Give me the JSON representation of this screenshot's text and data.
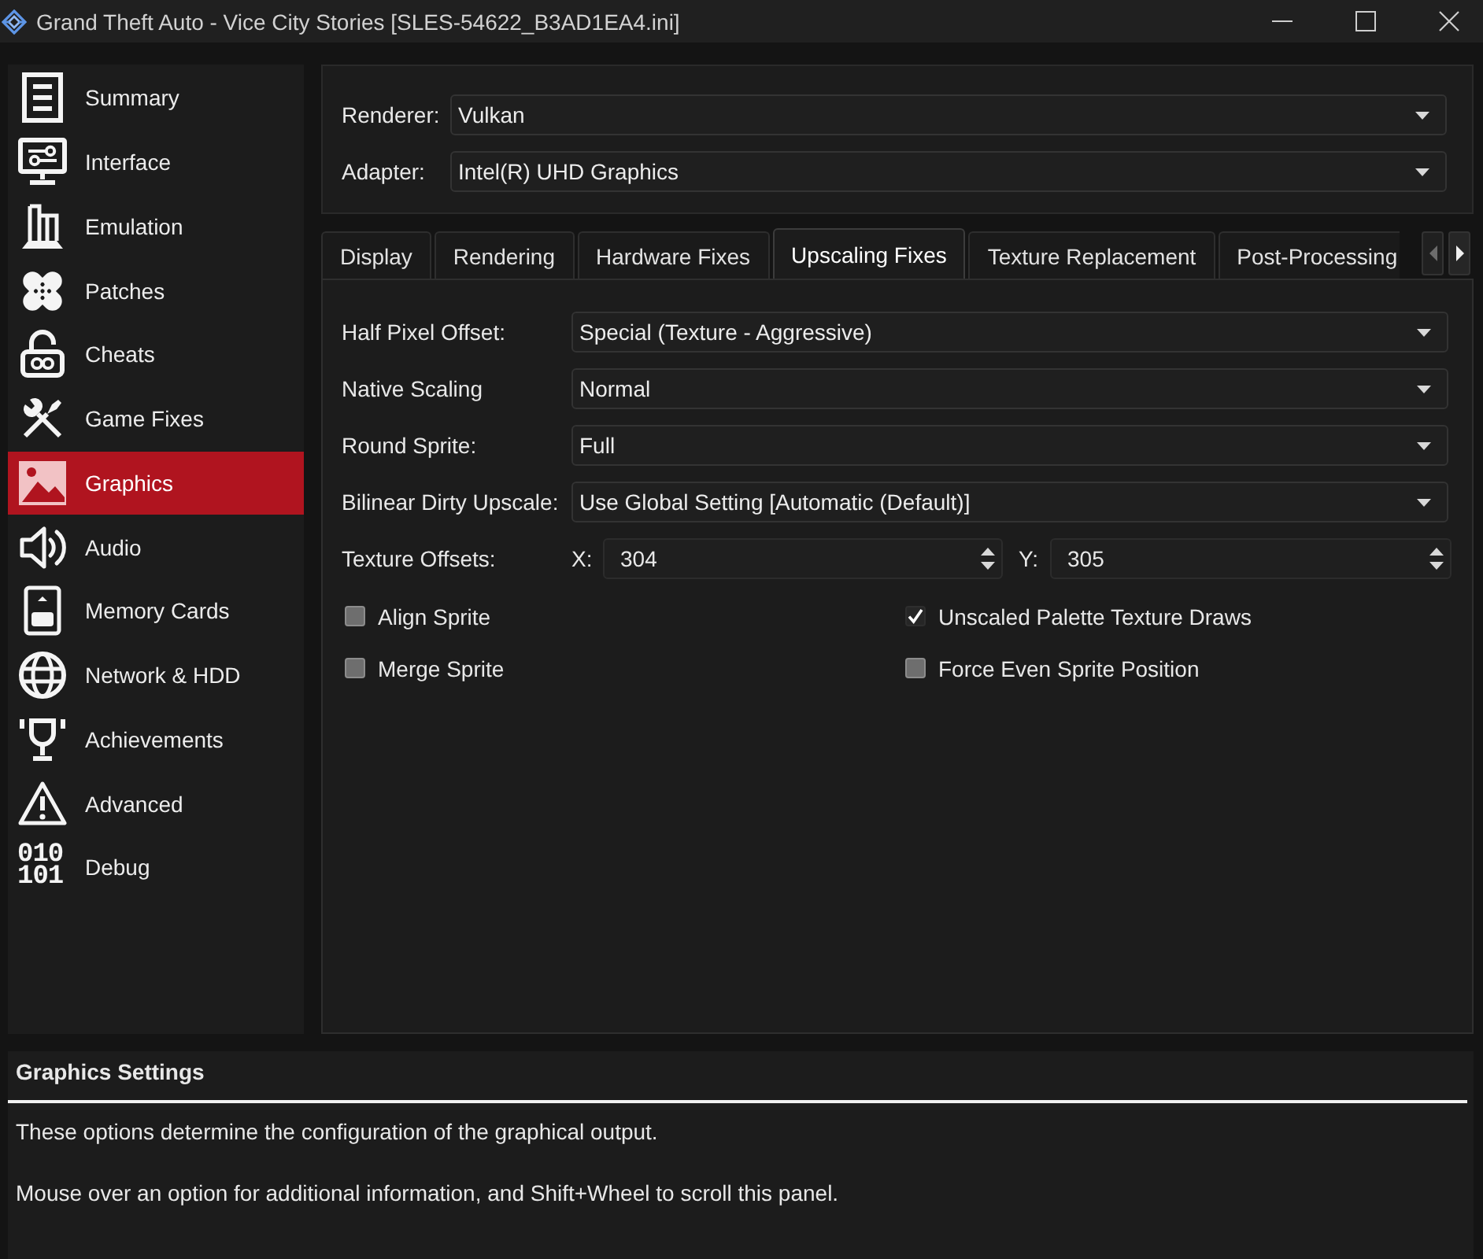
{
  "window": {
    "title": "Grand Theft Auto - Vice City Stories [SLES-54622_B3AD1EA4.ini]"
  },
  "sidebar": {
    "items": [
      {
        "label": "Summary",
        "selected": false
      },
      {
        "label": "Interface",
        "selected": false
      },
      {
        "label": "Emulation",
        "selected": false
      },
      {
        "label": "Patches",
        "selected": false
      },
      {
        "label": "Cheats",
        "selected": false
      },
      {
        "label": "Game Fixes",
        "selected": false
      },
      {
        "label": "Graphics",
        "selected": true
      },
      {
        "label": "Audio",
        "selected": false
      },
      {
        "label": "Memory Cards",
        "selected": false
      },
      {
        "label": "Network & HDD",
        "selected": false
      },
      {
        "label": "Achievements",
        "selected": false
      },
      {
        "label": "Advanced",
        "selected": false
      },
      {
        "label": "Debug",
        "selected": false,
        "icon_text": [
          "010",
          "101"
        ]
      }
    ]
  },
  "device": [
    {
      "label": "Renderer:",
      "value": "Vulkan"
    },
    {
      "label": "Adapter:",
      "value": "Intel(R) UHD Graphics"
    }
  ],
  "tabs": [
    {
      "label": "Display",
      "selected": false
    },
    {
      "label": "Rendering",
      "selected": false
    },
    {
      "label": "Hardware Fixes",
      "selected": false
    },
    {
      "label": "Upscaling Fixes",
      "selected": true
    },
    {
      "label": "Texture Replacement",
      "selected": false
    },
    {
      "label": "Post-Processing",
      "selected": false
    }
  ],
  "tab_scroll_buttons": [
    {
      "kind": "left",
      "disabled": true
    },
    {
      "kind": "right",
      "disabled": false
    }
  ],
  "settings": [
    {
      "kind": "dropdown",
      "label": "Half Pixel Offset:",
      "value": "Special (Texture - Aggressive)"
    },
    {
      "kind": "dropdown",
      "label": "Native Scaling",
      "value": "Normal"
    },
    {
      "kind": "dropdown",
      "label": "Round Sprite:",
      "value": "Full"
    },
    {
      "kind": "dropdown",
      "label": "Bilinear Dirty Upscale:",
      "value": "Use Global Setting [Automatic (Default)]"
    },
    {
      "kind": "offsets",
      "label": "Texture Offsets:",
      "fields": [
        {
          "label": "X:",
          "value": "304"
        },
        {
          "label": "Y:",
          "value": "305"
        }
      ]
    }
  ],
  "checkboxes": [
    {
      "label": "Align Sprite",
      "checked": false
    },
    {
      "label": "Unscaled Palette Texture Draws",
      "checked": true
    },
    {
      "label": "Merge Sprite",
      "checked": false
    },
    {
      "label": "Force Even Sprite Position",
      "checked": false
    }
  ],
  "help": {
    "title": "Graphics Settings",
    "paragraphs": [
      "These options determine the configuration of the graphical output.",
      "Mouse over an option for additional information, and Shift+Wheel to scroll this panel."
    ]
  }
}
